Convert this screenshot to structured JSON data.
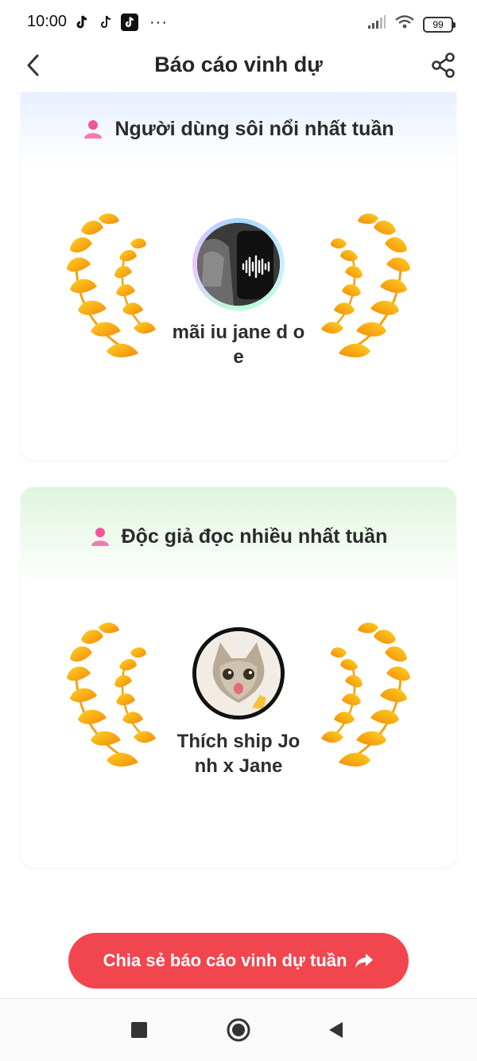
{
  "status_bar": {
    "time": "10:00",
    "dots": "···",
    "battery": "99",
    "icons": [
      "tiktok-icon",
      "tiktok-icon",
      "tiktok-icon",
      "signal-icon",
      "wifi-icon",
      "battery-icon"
    ]
  },
  "header": {
    "title": "Báo cáo vinh dự",
    "back_icon": "chevron-left-icon",
    "share_icon": "share-icon"
  },
  "cards": [
    {
      "heading": "Người dùng sôi nổi nhất tuần",
      "user_name": "mãi iu jane d oe",
      "accent": "#e7f0ff"
    },
    {
      "heading": "Độc giả đọc nhiều nhất tuần",
      "user_name": "Thích ship Jo nh x Jane",
      "accent": "#dff5dd"
    }
  ],
  "share_button": {
    "label": "Chia sẻ báo cáo vinh dự tuần",
    "color": "#f2464e"
  },
  "nav": {
    "icons": [
      "recent-apps-icon",
      "home-icon",
      "back-icon"
    ]
  }
}
